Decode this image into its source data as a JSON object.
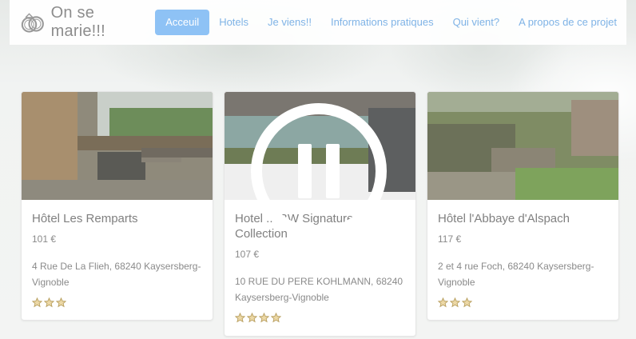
{
  "brand": {
    "title": "On se marie!!!",
    "icon": "wedding-rings-icon"
  },
  "nav": {
    "items": [
      {
        "label": "Acceuil",
        "active": true
      },
      {
        "label": "Hotels"
      },
      {
        "label": "Je viens!!"
      },
      {
        "label": "Informations pratiques"
      },
      {
        "label": "Qui vient?"
      },
      {
        "label": "A propos de ce projet"
      }
    ]
  },
  "hotels": [
    {
      "name": "Hôtel Les Remparts",
      "price": "101 €",
      "address": "4 Rue De La Flieh, 68240 Kaysersberg-Vignoble",
      "stars": 3
    },
    {
      "name": "Hotel ... BW Signature Collection",
      "price": "107 €",
      "address": "10 RUE DU PERE KOHLMANN, 68240 Kaysersberg-Vignoble",
      "stars": 4
    },
    {
      "name": "Hôtel l'Abbaye d'Alspach",
      "price": "117 €",
      "address": "2 et 4 rue Foch, 68240 Kaysersberg-Vignoble",
      "stars": 3
    }
  ],
  "overlay": {
    "icon": "pause-icon"
  },
  "colors": {
    "accent": "#8ec2f5",
    "link": "#7fb3e6",
    "star": "#d9b35f"
  }
}
